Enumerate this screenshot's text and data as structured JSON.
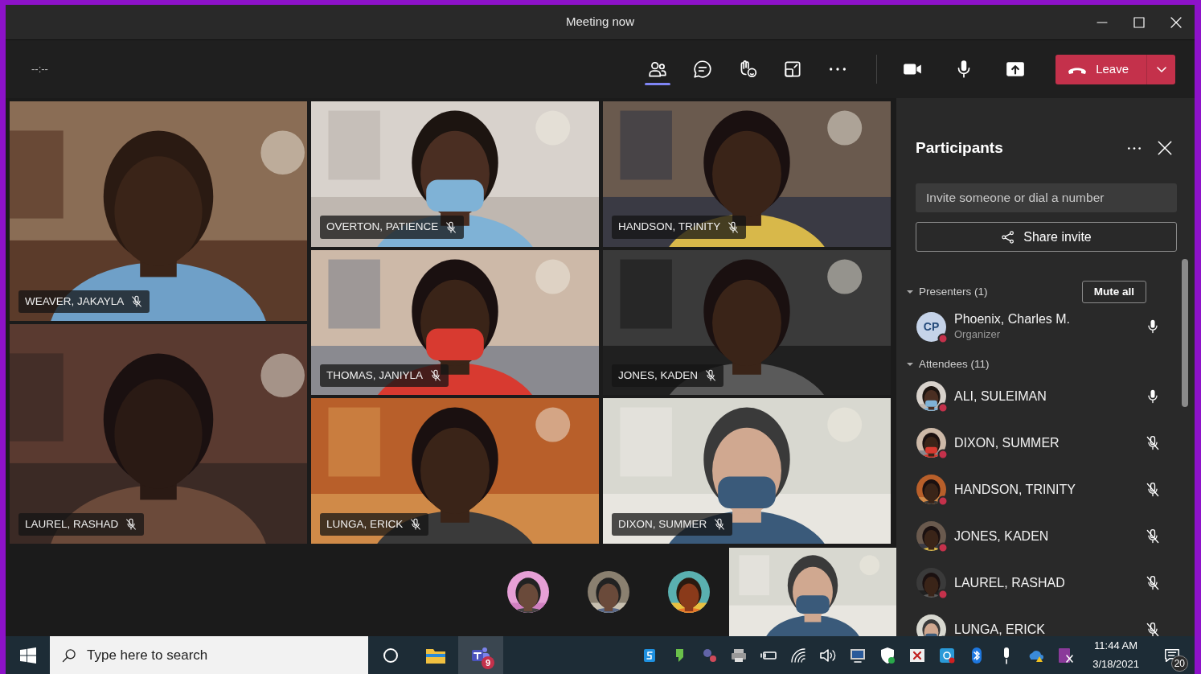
{
  "window": {
    "title": "Meeting now"
  },
  "toolbar": {
    "timer": "--:--",
    "tools": [
      {
        "kind": "people",
        "selected": true
      },
      {
        "kind": "chat",
        "selected": false
      },
      {
        "kind": "react",
        "selected": false
      },
      {
        "kind": "rooms",
        "selected": false
      },
      {
        "kind": "more",
        "selected": false
      }
    ],
    "controls": [
      {
        "kind": "camera"
      },
      {
        "kind": "mic"
      },
      {
        "kind": "share"
      }
    ],
    "leave": "Leave"
  },
  "video_columns": [
    {
      "tiles": [
        {
          "name": "WEAVER, JAKAYLA",
          "muted": true
        },
        {
          "name": "LAUREL, RASHAD",
          "muted": true
        }
      ]
    },
    {
      "tiles": [
        {
          "name": "OVERTON, PATIENCE",
          "muted": true
        },
        {
          "name": "THOMAS, JANIYLA",
          "muted": true
        },
        {
          "name": "LUNGA, ERICK",
          "muted": true
        }
      ]
    },
    {
      "tiles": [
        {
          "name": "HANDSON, TRINITY",
          "muted": true
        },
        {
          "name": "JONES, KADEN",
          "muted": true
        },
        {
          "name": "DIXON, SUMMER",
          "muted": true
        }
      ]
    }
  ],
  "panel": {
    "title": "Participants",
    "invite": {
      "placeholder": "Invite someone or dial a number"
    },
    "share": "Share invite",
    "groups": [
      {
        "label": "Presenters (1)",
        "expanded": true,
        "action": "Mute all",
        "people": [
          {
            "name": "Phoenix, Charles M.",
            "role": "Organizer",
            "initials": "CP",
            "muted": false
          }
        ]
      },
      {
        "label": "Attendees (11)",
        "expanded": true,
        "people": [
          {
            "name": "ALI, SULEIMAN",
            "muted": false
          },
          {
            "name": "DIXON, SUMMER",
            "muted": true
          },
          {
            "name": "HANDSON, TRINITY",
            "muted": true
          },
          {
            "name": "JONES, KADEN",
            "muted": true
          },
          {
            "name": "LAUREL, RASHAD",
            "muted": true
          },
          {
            "name": "LUNGA, ERICK",
            "muted": true
          }
        ]
      }
    ]
  },
  "taskbar": {
    "search": {
      "placeholder": "Type here to search"
    },
    "teams_badge": "9",
    "time": "11:44 AM",
    "date": "3/18/2021",
    "notifications": "20"
  }
}
